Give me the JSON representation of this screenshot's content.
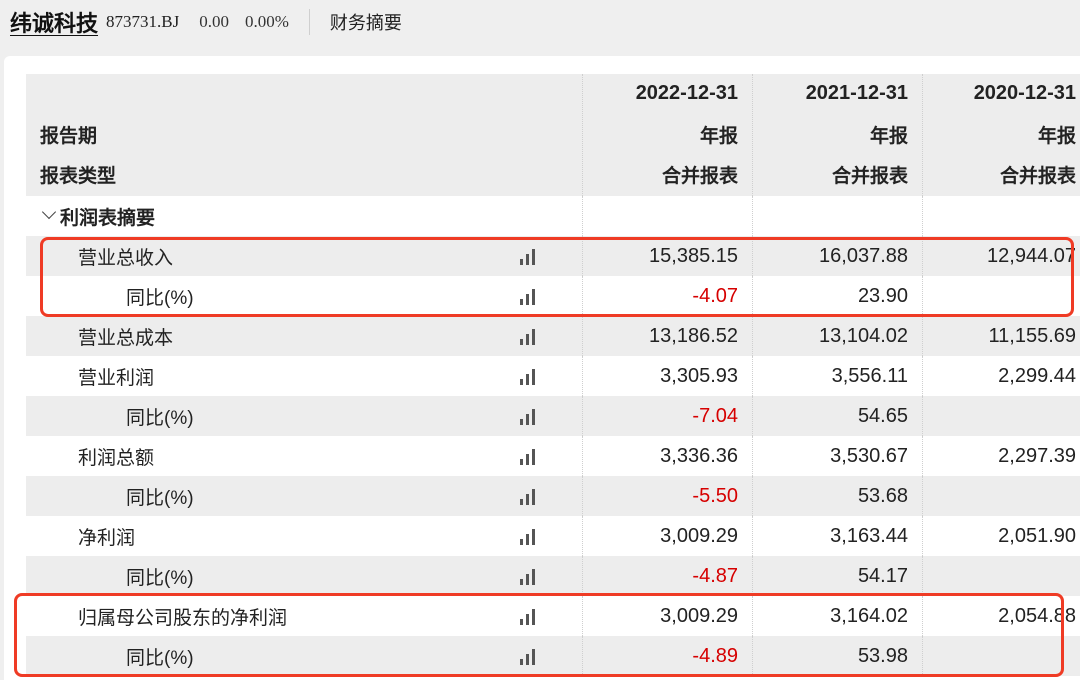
{
  "header": {
    "company": "纬诚科技",
    "code": "873731.BJ",
    "price": "0.00",
    "change_pct": "0.00%",
    "section": "财务摘要"
  },
  "table": {
    "head": {
      "period_label": "报告期",
      "type_label": "报表类型",
      "columns": [
        {
          "date": "2022-12-31",
          "period": "年报",
          "type": "合并报表"
        },
        {
          "date": "2021-12-31",
          "period": "年报",
          "type": "合并报表"
        },
        {
          "date": "2020-12-31",
          "period": "年报",
          "type": "合并报表"
        }
      ]
    },
    "section_title": "利润表摘要",
    "rows": [
      {
        "label": "营业总收入",
        "values": [
          "15,385.15",
          "16,037.88",
          "12,944.07"
        ]
      },
      {
        "label": "同比(%)",
        "values": [
          "-4.07",
          "23.90",
          ""
        ]
      },
      {
        "label": "营业总成本",
        "values": [
          "13,186.52",
          "13,104.02",
          "11,155.69"
        ]
      },
      {
        "label": "营业利润",
        "values": [
          "3,305.93",
          "3,556.11",
          "2,299.44"
        ]
      },
      {
        "label": "同比(%)",
        "values": [
          "-7.04",
          "54.65",
          ""
        ]
      },
      {
        "label": "利润总额",
        "values": [
          "3,336.36",
          "3,530.67",
          "2,297.39"
        ]
      },
      {
        "label": "同比(%)",
        "values": [
          "-5.50",
          "53.68",
          ""
        ]
      },
      {
        "label": "净利润",
        "values": [
          "3,009.29",
          "3,163.44",
          "2,051.90"
        ]
      },
      {
        "label": "同比(%)",
        "values": [
          "-4.87",
          "54.17",
          ""
        ]
      },
      {
        "label": "归属母公司股东的净利润",
        "values": [
          "3,009.29",
          "3,164.02",
          "2,054.88"
        ]
      },
      {
        "label": "同比(%)",
        "values": [
          "-4.89",
          "53.98",
          ""
        ]
      }
    ]
  },
  "colors": {
    "negative": "#d60000",
    "highlight": "#ef3b25"
  }
}
